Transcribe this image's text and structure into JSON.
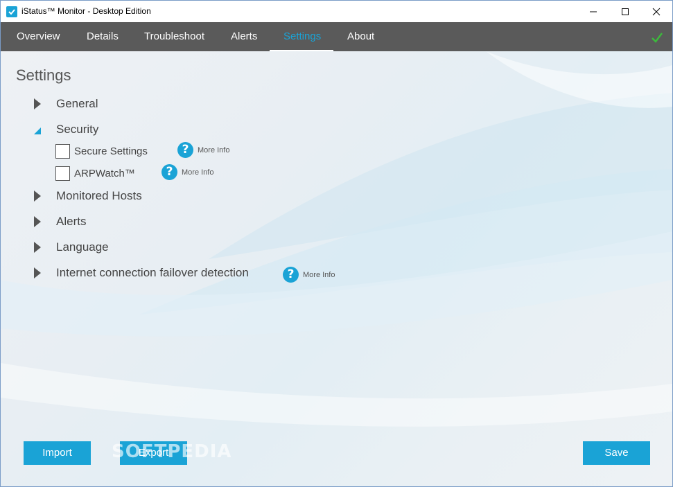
{
  "window": {
    "title": "iStatus™ Monitor - Desktop Edition"
  },
  "nav": {
    "tabs": [
      {
        "label": "Overview"
      },
      {
        "label": "Details"
      },
      {
        "label": "Troubleshoot"
      },
      {
        "label": "Alerts"
      },
      {
        "label": "Settings",
        "active": true
      },
      {
        "label": "About"
      }
    ],
    "status_icon": "checkmark-icon"
  },
  "settings": {
    "title": "Settings",
    "sections": [
      {
        "label": "General",
        "expanded": false
      },
      {
        "label": "Security",
        "expanded": true
      },
      {
        "label": "Monitored Hosts",
        "expanded": false
      },
      {
        "label": "Alerts",
        "expanded": false
      },
      {
        "label": "Language",
        "expanded": false
      },
      {
        "label": "Internet connection failover detection",
        "expanded": false
      }
    ],
    "security_options": [
      {
        "label": "Secure Settings",
        "checked": false
      },
      {
        "label": "ARPWatch™",
        "checked": false
      }
    ],
    "more_info_label": "More Info"
  },
  "buttons": {
    "import": "Import",
    "export": "Export",
    "save": "Save"
  },
  "watermark": "SOFTPEDIA",
  "colors": {
    "accent": "#1aa3d6",
    "navbar": "#5a5a5a",
    "ok": "#3cba3c"
  }
}
